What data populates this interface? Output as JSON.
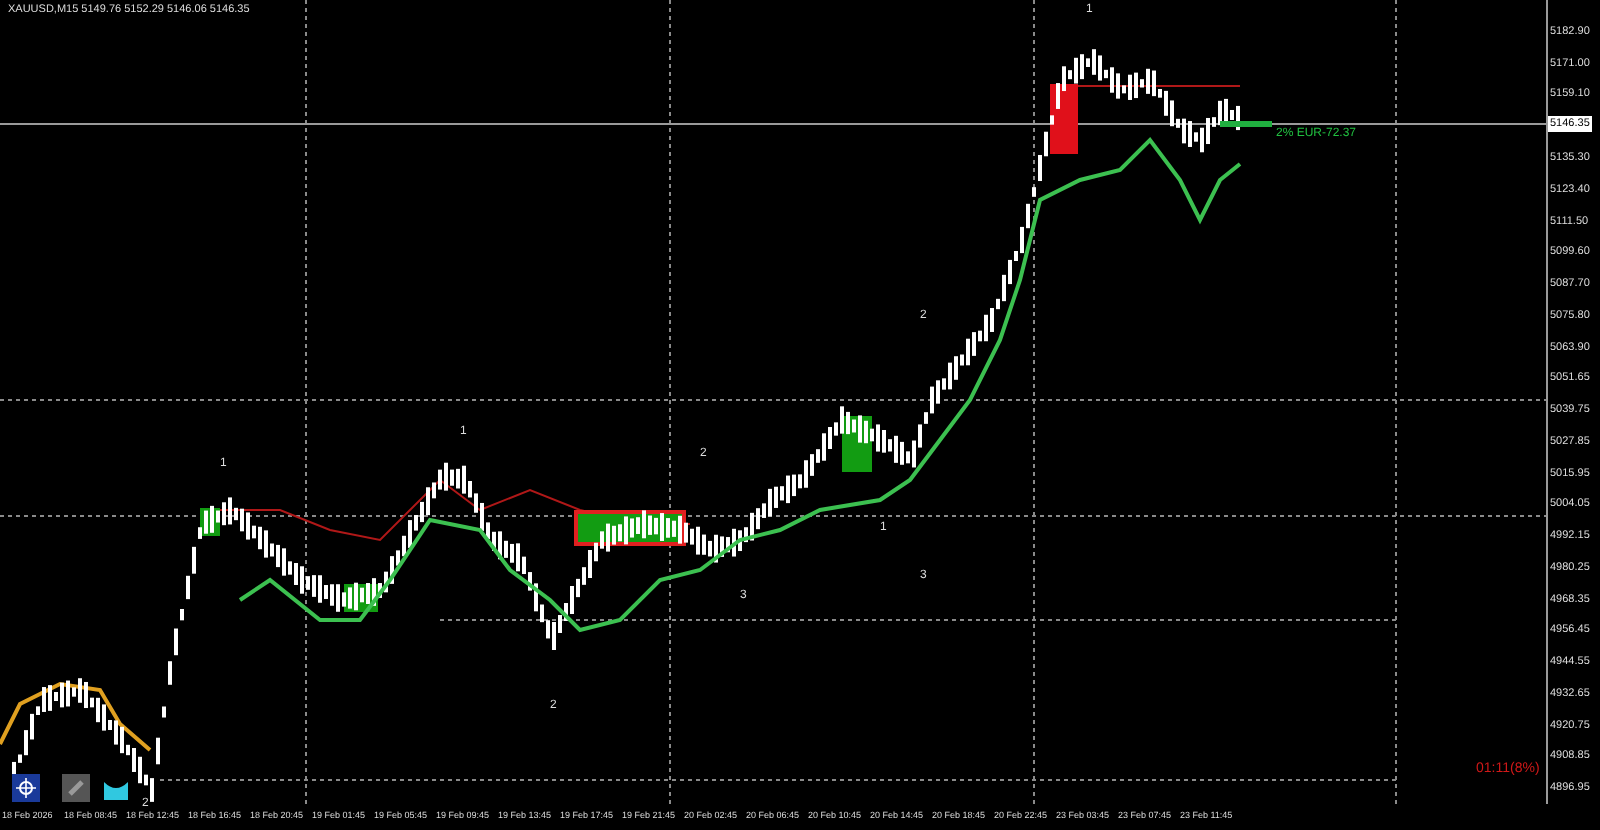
{
  "chart_title": "XAUUSD,M15  5149.76 5152.29 5146.06 5146.35",
  "price_axis": [
    "5182.90",
    "5171.00",
    "5159.10",
    "5135.30",
    "5123.40",
    "5111.50",
    "5099.60",
    "5087.70",
    "5075.80",
    "5063.90",
    "5051.65",
    "5039.75",
    "5027.85",
    "5015.95",
    "5004.05",
    "4992.15",
    "4980.25",
    "4968.35",
    "4956.45",
    "4944.55",
    "4932.65",
    "4920.75",
    "4908.85",
    "4896.95"
  ],
  "current_price": "5146.35",
  "time_axis": [
    "18 Feb 2026",
    "18 Feb 08:45",
    "18 Feb 12:45",
    "18 Feb 16:45",
    "18 Feb 20:45",
    "19 Feb 01:45",
    "19 Feb 05:45",
    "19 Feb 09:45",
    "19 Feb 13:45",
    "19 Feb 17:45",
    "19 Feb 21:45",
    "20 Feb 02:45",
    "20 Feb 06:45",
    "20 Feb 10:45",
    "20 Feb 14:45",
    "20 Feb 18:45",
    "20 Feb 22:45",
    "23 Feb 03:45",
    "23 Feb 07:45",
    "23 Feb 11:45"
  ],
  "position_label": "2% EUR-72.37",
  "bar_timer": "01:11(8%)",
  "wave_labels": [
    "1",
    "1",
    "1",
    "2",
    "2",
    "1",
    "3",
    "3",
    "2",
    "2"
  ]
}
